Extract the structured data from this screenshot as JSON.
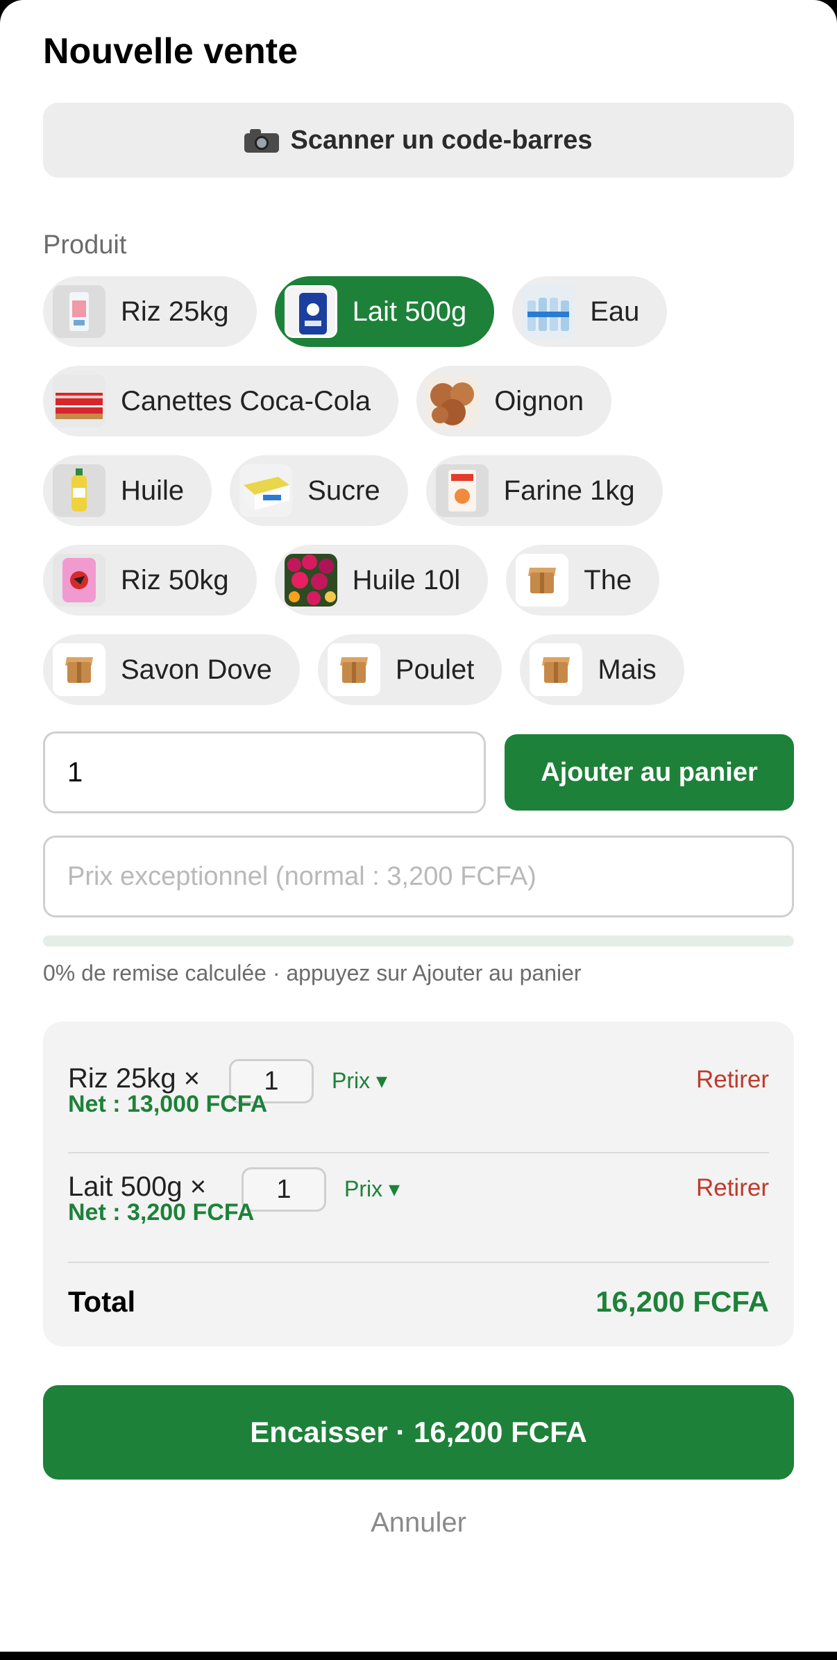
{
  "header": {
    "title": "Nouvelle vente"
  },
  "scan": {
    "label": "Scanner un code-barres",
    "icon": "camera-icon"
  },
  "product_section": {
    "label": "Produit"
  },
  "products": [
    {
      "label": "Riz 25kg",
      "thumb": "rice-bag",
      "selected": false
    },
    {
      "label": "Lait 500g",
      "thumb": "milk-pack",
      "selected": true
    },
    {
      "label": "Eau",
      "thumb": "water-bottles",
      "selected": false
    },
    {
      "label": "Canettes Coca-Cola",
      "thumb": "soda-cans",
      "selected": false
    },
    {
      "label": "Oignon",
      "thumb": "onions",
      "selected": false
    },
    {
      "label": "Huile",
      "thumb": "oil-bottle",
      "selected": false
    },
    {
      "label": "Sucre",
      "thumb": "sugar-box",
      "selected": false
    },
    {
      "label": "Farine 1kg",
      "thumb": "flour-bag",
      "selected": false
    },
    {
      "label": "Riz 50kg",
      "thumb": "rice-sack",
      "selected": false
    },
    {
      "label": "Huile 10l",
      "thumb": "flowers",
      "selected": false
    },
    {
      "label": "The",
      "thumb": "package-icon",
      "selected": false
    },
    {
      "label": "Savon Dove",
      "thumb": "package-icon",
      "selected": false
    },
    {
      "label": "Poulet",
      "thumb": "package-icon",
      "selected": false
    },
    {
      "label": "Mais",
      "thumb": "package-icon",
      "selected": false
    }
  ],
  "quantity": {
    "value": "1"
  },
  "add_to_cart": {
    "label": "Ajouter au panier"
  },
  "special_price": {
    "placeholder": "Prix exceptionnel (normal : 3,200 FCFA)"
  },
  "discount": {
    "percent": 0,
    "hint": "0% de remise calculée · appuyez sur Ajouter au panier"
  },
  "cart": {
    "items": [
      {
        "name": "Riz 25kg ×",
        "qty": "1",
        "price_menu": "Prix ▾",
        "net": "Net : 13,000 FCFA",
        "remove": "Retirer"
      },
      {
        "name": "Lait 500g ×",
        "qty": "1",
        "price_menu": "Prix ▾",
        "net": "Net : 3,200 FCFA",
        "remove": "Retirer"
      }
    ],
    "total_label": "Total",
    "total_value": "16,200 FCFA"
  },
  "checkout": {
    "label": "Encaisser · 16,200 FCFA"
  },
  "cancel": {
    "label": "Annuler"
  },
  "colors": {
    "accent": "#1d8139",
    "danger": "#c0392b",
    "chip_bg": "#ededed"
  }
}
